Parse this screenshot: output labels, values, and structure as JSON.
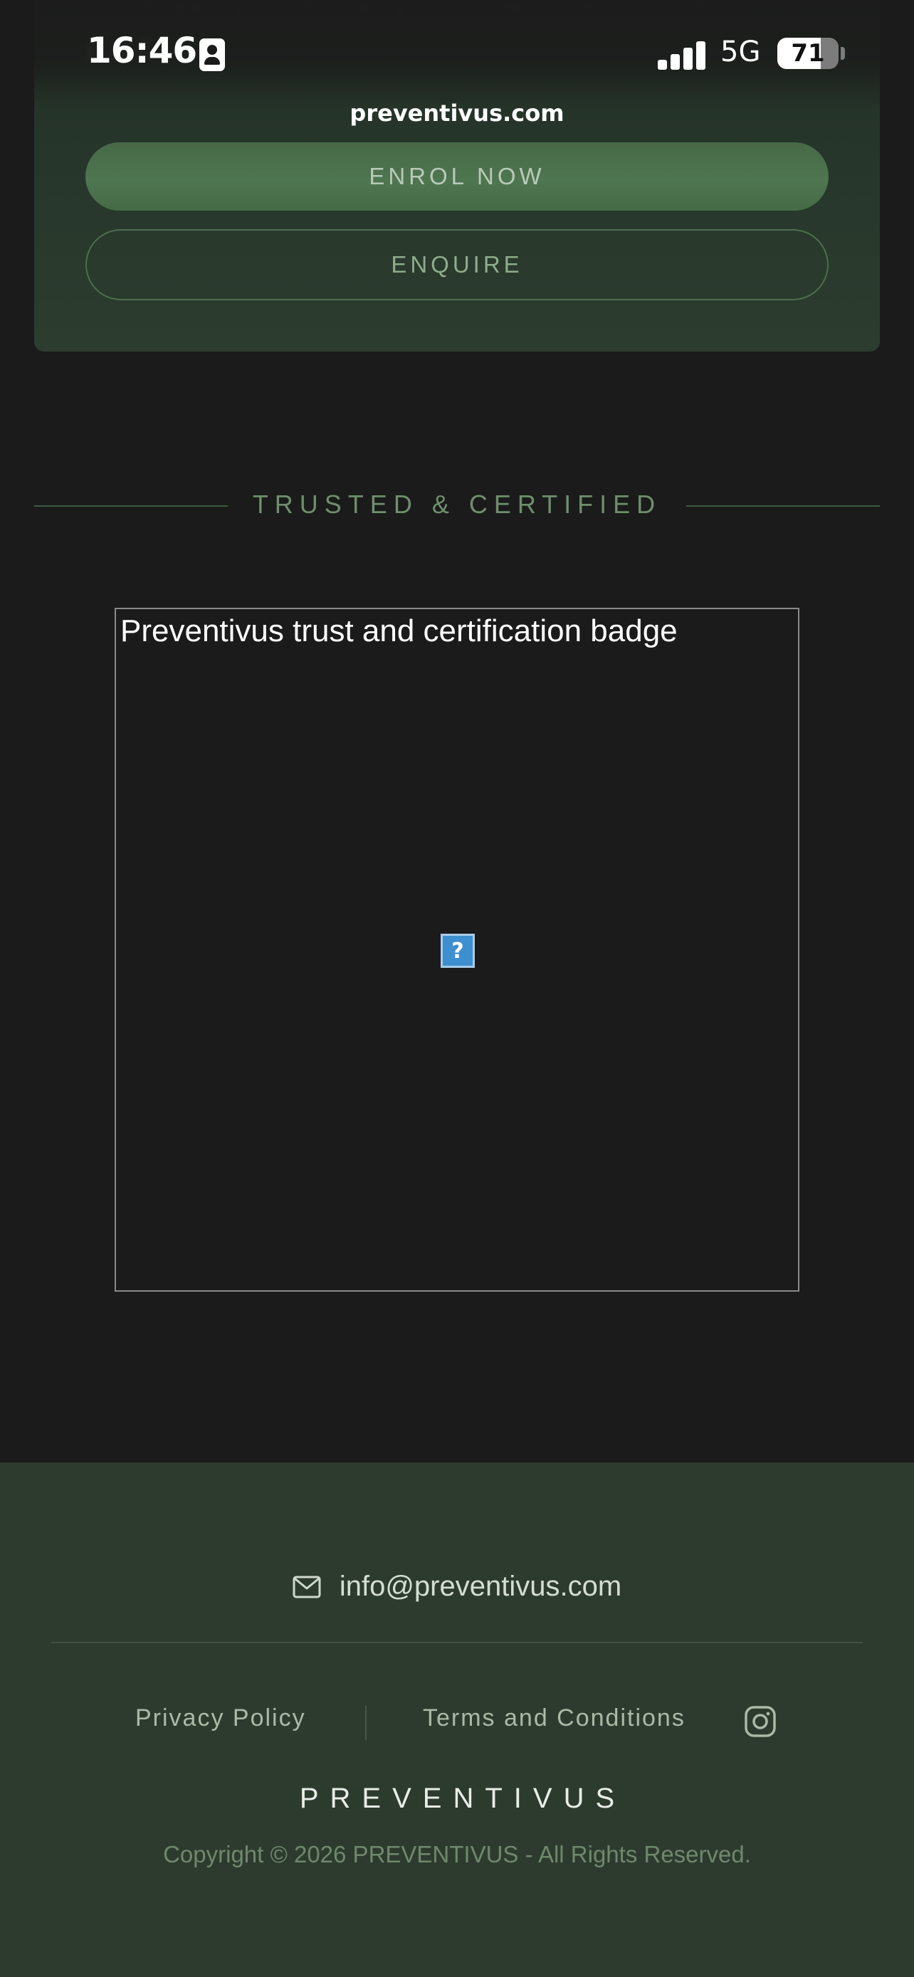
{
  "status_bar": {
    "time": "16:46",
    "network": "5G",
    "battery_level": "71",
    "battery_fraction": 0.71
  },
  "browser": {
    "url": "preventivus.com"
  },
  "promo_card": {
    "enrol_label": "ENROL NOW",
    "enquire_label": "ENQUIRE"
  },
  "trust_section": {
    "heading": "TRUSTED & CERTIFIED",
    "badge_alt": "Preventivus trust and certification badge",
    "broken_image_glyph": "?"
  },
  "footer": {
    "email": "info@preventivus.com",
    "privacy_label": "Privacy Policy",
    "terms_label": "Terms and Conditions",
    "brand": "PREVENTIVUS",
    "copyright": "Copyright © 2026 PREVENTIVUS - All Rights Reserved."
  },
  "colors": {
    "page_background": "#1b1b1b",
    "footer_background": "#2d3b2f",
    "accent_green": "#4e7650",
    "heading_green": "#6e8f6c"
  },
  "icons": {
    "status": [
      "contact-card-icon",
      "signal-icon",
      "battery-icon"
    ],
    "footer": [
      "mail-icon",
      "instagram-icon"
    ]
  }
}
